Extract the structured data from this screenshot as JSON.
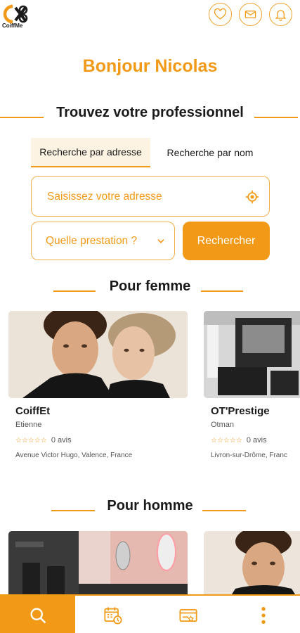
{
  "app": {
    "logo_text": "CoiffMe"
  },
  "header": {
    "icons": [
      "heart-icon",
      "mail-icon",
      "bell-icon"
    ]
  },
  "greeting": "Bonjour Nicolas",
  "search": {
    "title": "Trouvez votre professionnel",
    "tabs": [
      {
        "label": "Recherche par adresse",
        "active": true
      },
      {
        "label": "Recherche par nom",
        "active": false
      }
    ],
    "address_placeholder": "Saisissez votre adresse",
    "service_placeholder": "Quelle prestation ?",
    "search_button": "Rechercher"
  },
  "sections": {
    "women": {
      "title": "Pour femme",
      "cards": [
        {
          "name": "CoiffEt",
          "owner": "Etienne",
          "stars": "☆☆☆☆☆",
          "reviews": "0 avis",
          "address": "Avenue Victor Hugo, Valence, France"
        },
        {
          "name": "OT'Prestige",
          "owner": "Otman",
          "stars": "☆☆☆☆☆",
          "reviews": "0 avis",
          "address": "Livron-sur-Drôme, Franc"
        }
      ]
    },
    "men": {
      "title": "Pour homme"
    }
  },
  "bottom_nav": [
    {
      "icon": "search-icon",
      "active": true
    },
    {
      "icon": "calendar-clock-icon",
      "active": false
    },
    {
      "icon": "card-icon",
      "active": false
    },
    {
      "icon": "more-vertical-icon",
      "active": false
    }
  ],
  "colors": {
    "accent": "#f29a17",
    "accent_light": "#fdf3e3"
  }
}
